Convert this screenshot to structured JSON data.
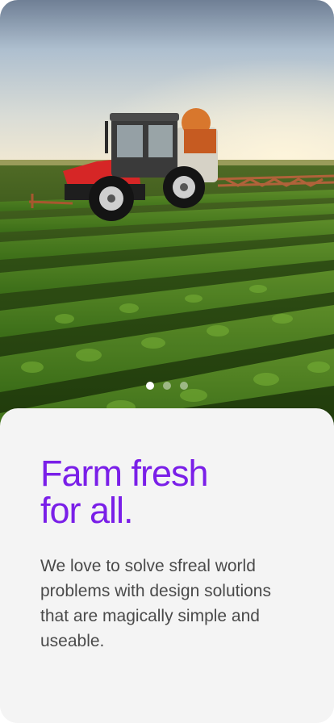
{
  "colors": {
    "accent": "#7a1fe8",
    "body_text": "#4a4a4a",
    "card_bg": "#f4f4f4"
  },
  "hero": {
    "image": "tractor-spraying-crop-field",
    "carousel": {
      "total": 3,
      "active_index": 0
    }
  },
  "card": {
    "headline_line1": "Farm fresh",
    "headline_line2": "for all.",
    "body": "We love to solve sfreal world problems with design solutions that are magically simple and useable."
  }
}
